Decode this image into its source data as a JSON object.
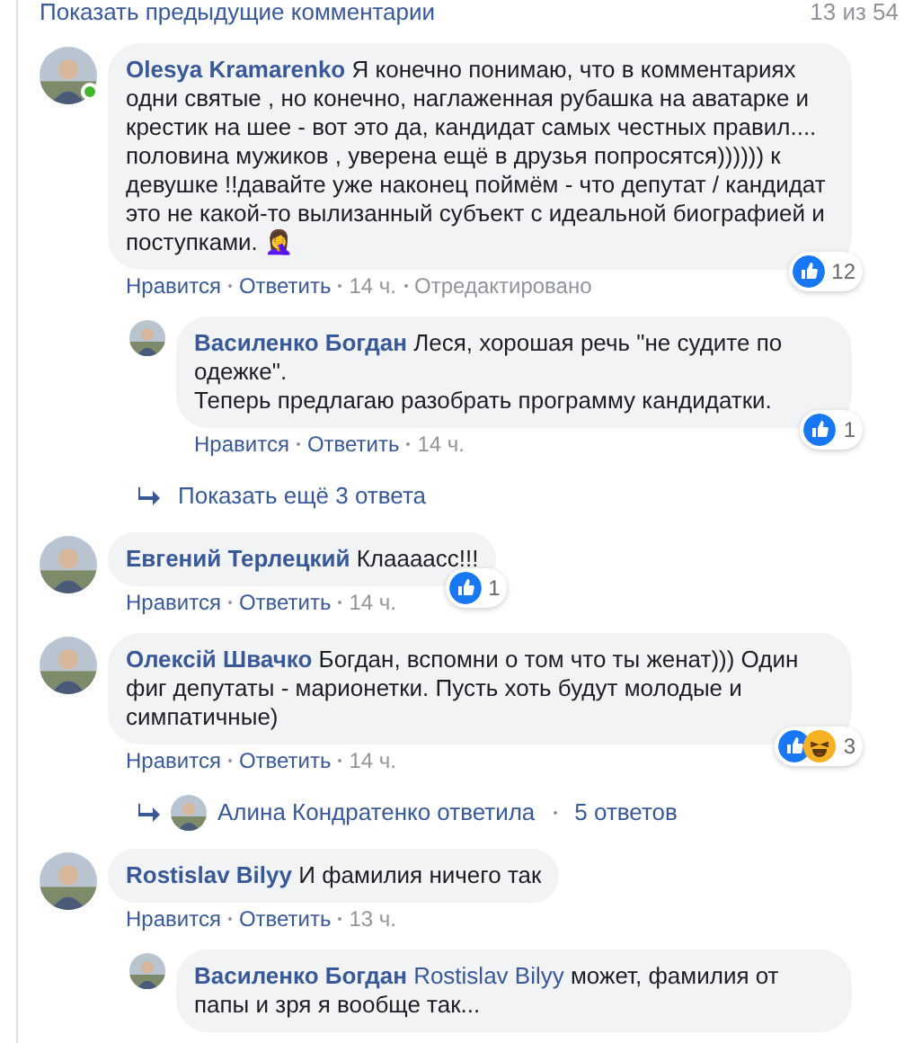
{
  "header": {
    "link": "Показать предыдущие комментарии",
    "count": "13 из 54"
  },
  "items": [
    {
      "kind": "comment",
      "author": "Olesya Kramarenko",
      "online": true,
      "text": "Я конечно понимаю, что в комментариях одни святые , но конечно, наглаженная рубашка на аватарке и крестик на шее - вот это да, кандидат самых честных правил.... половина мужиков , уверена ещё в друзья попросятся)))))) к девушке !!давайте уже наконец поймём - что депутат / кандидат это не какой-то вылизанный субъект с идеальной биографией и поступками. 🤦‍♀️",
      "actions": [
        "Нравится",
        "Ответить",
        "14 ч.",
        "Отредактировано"
      ],
      "reactions": {
        "count": "12"
      }
    },
    {
      "kind": "reply",
      "author": "Василенко Богдан",
      "text": "Леся, хорошая речь \"не судите по одежке\".\nТеперь предлагаю разобрать программу кандидатки.",
      "actions": [
        "Нравится",
        "Ответить",
        "14 ч."
      ],
      "reactions": {
        "count": "1"
      }
    },
    {
      "kind": "more",
      "text": "Показать ещё 3 ответа"
    },
    {
      "kind": "comment",
      "author": "Евгений Терлецкий",
      "text": "Клаааасс!!!",
      "actions": [
        "Нравится",
        "Ответить",
        "14 ч."
      ],
      "reactions": {
        "count": "1"
      }
    },
    {
      "kind": "comment",
      "author": "Олексій Швачко",
      "text": "Богдан, вспомни о том что ты женат))) Один фиг депутаты - марионетки. Пусть хоть будут молодые и симпатичные)",
      "actions": [
        "Нравится",
        "Ответить",
        "14 ч."
      ],
      "reactions": {
        "count": "3",
        "haha": true
      }
    },
    {
      "kind": "replied",
      "text": "Алина Кондратенко ответила",
      "count": "5 ответов"
    },
    {
      "kind": "comment",
      "author": "Rostislav Bilyy",
      "text": "И фамилия ничего так",
      "actions": [
        "Нравится",
        "Ответить",
        "13 ч."
      ]
    },
    {
      "kind": "reply",
      "author": "Василенко Богдан",
      "mention": "Rostislav Bilyy",
      "text": "может, фамилия от папы и зря я вообще так..."
    }
  ]
}
